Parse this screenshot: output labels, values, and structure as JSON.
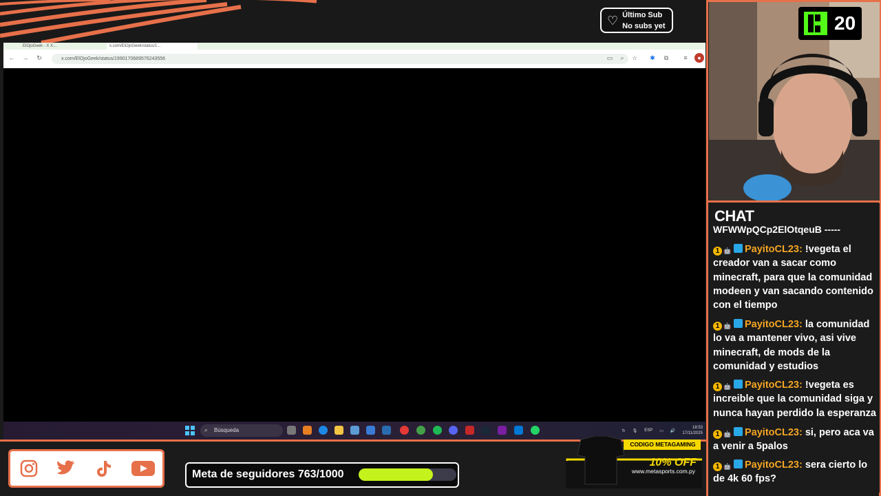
{
  "sub_widget": {
    "line1": "Último Sub",
    "line2": "No subs yet"
  },
  "browser": {
    "tabs": [
      "ElOjoGeek - X X...",
      "x.com/ElOjoGeek/status/1..."
    ],
    "url": "x.com/ElOjoGeek/status/1990170689576243556"
  },
  "taskbar": {
    "search_placeholder": "Búsqueda",
    "lang": "ESP",
    "time": "18:53",
    "date": "17/11/2025"
  },
  "kick": {
    "count": "20"
  },
  "chat": {
    "title": "CHAT",
    "cutoff_line": "WFWWpQCp2ElOtqeuB -----",
    "messages": [
      {
        "user": "PayitoCL23:",
        "text": " !vegeta el creador van a sacar como minecraft, para que la comunidad modeen y van sacando contenido con el tiempo"
      },
      {
        "user": "PayitoCL23:",
        "text": " la comunidad lo va a mantener vivo, asi vive minecraft, de mods de la comunidad y estudios"
      },
      {
        "user": "PayitoCL23:",
        "text": " !vegeta es increible que la comunidad siga y nunca hayan perdido la esperanza"
      },
      {
        "user": "PayitoCL23:",
        "text": " si, pero aca va a venir a 5palos"
      },
      {
        "user": "PayitoCL23:",
        "text": " sera cierto lo de 4k 60 fps?"
      }
    ]
  },
  "goal": {
    "label": "Meta de seguidores 763/1000",
    "progress": 0.763
  },
  "ad": {
    "code_label": "CODIGO METAGAMING",
    "offer": "10% OFF",
    "site": "www.metasports.com.py"
  },
  "colors": {
    "accent": "#e6704a",
    "kick_green": "#53fc18",
    "goal_fill": "#c4f21c",
    "chat_user": "#f5a623"
  }
}
